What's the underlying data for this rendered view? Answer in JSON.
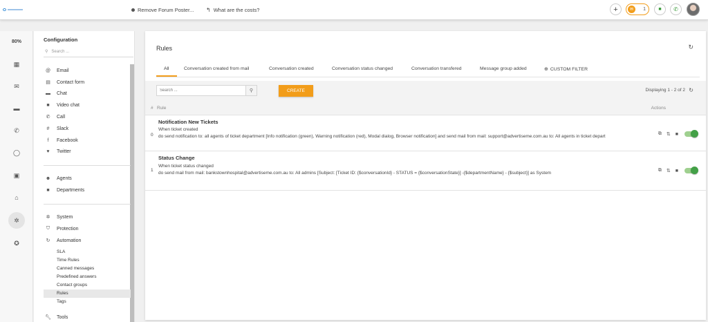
{
  "topbar": {
    "crumb_forum": "Remove Forum Poster...",
    "crumb_costs": "What are the costs?",
    "mail_count": "1",
    "icons": [
      "add-circle-icon",
      "mail-icon",
      "chat-icon",
      "phone-icon"
    ]
  },
  "rail": {
    "percent": "80%",
    "icons": [
      "dashboard-icon",
      "mail-icon",
      "chat-icon",
      "phone-icon",
      "circle-sync-icon",
      "contacts-icon",
      "bank-icon",
      "settings-icon",
      "star-icon"
    ]
  },
  "config": {
    "title": "Configuration",
    "search_placeholder": "Search ...",
    "channels": [
      {
        "label": "Email",
        "icon": "at-icon"
      },
      {
        "label": "Contact form",
        "icon": "form-icon"
      },
      {
        "label": "Chat",
        "icon": "chat-icon"
      },
      {
        "label": "Video chat",
        "icon": "video-icon"
      },
      {
        "label": "Call",
        "icon": "phone-icon"
      },
      {
        "label": "Slack",
        "icon": "slack-icon"
      },
      {
        "label": "Facebook",
        "icon": "facebook-icon"
      },
      {
        "label": "Twitter",
        "icon": "twitter-icon"
      }
    ],
    "people": [
      {
        "label": "Agents",
        "icon": "people-icon"
      },
      {
        "label": "Departments",
        "icon": "folder-icon"
      }
    ],
    "system": [
      {
        "label": "System",
        "icon": "gear-icon"
      },
      {
        "label": "Protection",
        "icon": "shield-icon"
      },
      {
        "label": "Automation",
        "icon": "sync-icon"
      }
    ],
    "automation_items": [
      "SLA",
      "Time Rules",
      "Canned messages",
      "Predefined answers",
      "Contact groups",
      "Rules",
      "Tags"
    ],
    "tools": {
      "label": "Tools",
      "icon": "wrench-icon"
    }
  },
  "main": {
    "title": "Rules",
    "tabs": [
      "All",
      "Conversation created from mail",
      "Conversation created",
      "Conversation status changed",
      "Conversation transfered",
      "Message group added"
    ],
    "custom_filter": "CUSTOM FILTER",
    "search_placeholder": "Search ...",
    "create_label": "CREATE",
    "displaying": "Displaying 1 - 2 of 2",
    "col_num": "#",
    "col_rule": "Rule",
    "col_actions": "Actions",
    "rules": [
      {
        "num": "0",
        "title": "Notification New Tickets",
        "trigger": "When ticket created",
        "action": "do send notification to: all agents of ticket department [Info notification (green), Warning notification (red), Modal dialog, Browser notification] and send mail from mail: support@advertiseme.com.au to: All agents in ticket depart",
        "enabled": true
      },
      {
        "num": "1",
        "title": "Status Change",
        "trigger": "When ticket status changed",
        "action": "do send mail from mail: bankstownhospital@advertiseme.com.au to: All admins [Subject: [Ticket ID: {$conversationId} - STATUS = {$conversationState}] -{$departmentName} - {$subject}] as System",
        "enabled": true
      }
    ]
  },
  "colors": {
    "accent": "#f29d1a",
    "toggle_on": "#43a047"
  }
}
